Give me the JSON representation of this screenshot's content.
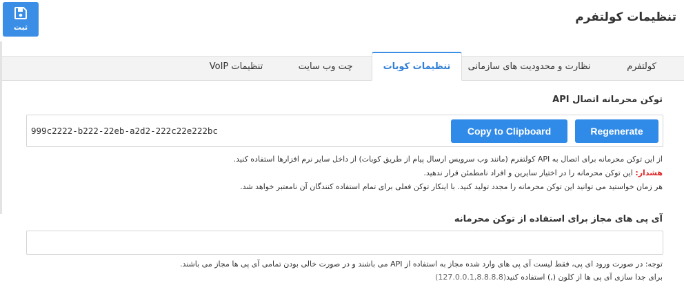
{
  "toolbar": {
    "save_label": "ثبت"
  },
  "page": {
    "title": "تنظیمات کولتفرم"
  },
  "tabs": [
    {
      "label": "کولتفرم"
    },
    {
      "label": "نظارت و محدودیت های سازمانی"
    },
    {
      "label": "تنظیمات کوبات"
    },
    {
      "label": "چت وب سایت"
    },
    {
      "label": "تنظیمات VoIP"
    }
  ],
  "api_token": {
    "label": "توکن محرمانه اتصال API",
    "value": "999c2222-b222-22eb-a2d2-222c22e222bc",
    "regenerate_label": "Regenerate",
    "copy_label": "Copy to Clipboard",
    "help_line1": "از این توکن محرمانه برای اتصال به API کولتفرم (مانند وب سرویس ارسال پیام از طریق کوبات) از داخل سایر نرم افزارها استفاده کنید.",
    "warning_label": "هشدار:",
    "warning_text": " این توکن محرمانه را در اختیار سایرین و افراد نامطمئن قرار ندهید.",
    "help_line3": "هر زمان خواستید می توانید این توکن محرمانه را مجدد تولید کنید. با اینکار توکن فعلی برای تمام استفاده کنندگان آن نامعتبر خواهد شد."
  },
  "allowed_ips": {
    "label": "آی پی های مجاز برای استفاده از توکن محرمانه",
    "value": "",
    "note_line1": "توجه: در صورت ورود ای پی، فقط لیست آی پی های وارد شده مجاز به استفاده از API می باشند و در صورت خالی بودن تمامی آی پی ها مجاز می باشند.",
    "note_line2": "برای جدا سازی آی پی ها از کلون (,) استفاده کنید",
    "note_example": "(127.0.0.1,8.8.8.8)"
  },
  "colors": {
    "accent": "#2f8ae8",
    "warning": "#e02a2a"
  }
}
